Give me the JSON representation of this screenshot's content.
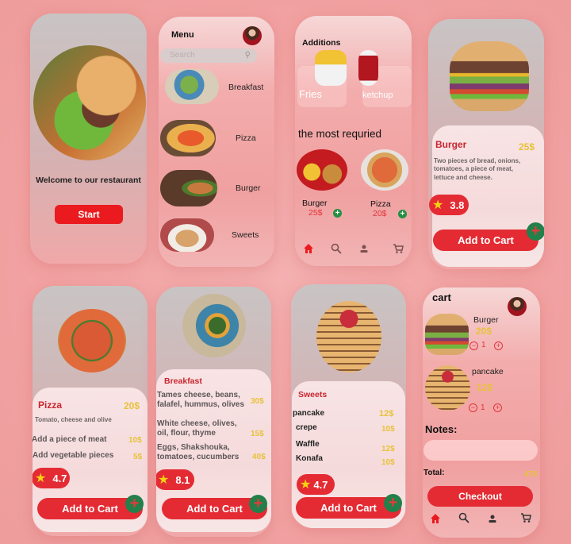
{
  "colors": {
    "accent_red": "#e42b33",
    "title_red": "#c9252f",
    "price_gold": "#e7c23a",
    "plus_green": "#24804a",
    "background_pink": "#f2a2a2"
  },
  "welcome": {
    "image": "burger-photo",
    "title": "Welcome to our restaurant",
    "start_label": "Start"
  },
  "menu": {
    "title": "Menu",
    "avatar": "user-avatar",
    "search_placeholder": "Search",
    "categories": [
      {
        "label": "Breakfast",
        "image": "breakfast-photo"
      },
      {
        "label": "Pizza",
        "image": "pizza-photo"
      },
      {
        "label": "Burger",
        "image": "burger-photo"
      },
      {
        "label": "Sweets",
        "image": "pancake-photo"
      }
    ]
  },
  "home": {
    "additions_title": "Additions",
    "additions": [
      {
        "label": "Fries",
        "image": "fries-photo"
      },
      {
        "label": "ketchup",
        "image": "ketchup-photo"
      }
    ],
    "popular_title": "the most requried",
    "popular": [
      {
        "name": "Burger",
        "price": "25$",
        "image": "burger-fries-photo"
      },
      {
        "name": "Pizza",
        "price": "20$",
        "image": "pizza-photo"
      }
    ],
    "nav": [
      "home-icon",
      "search-icon",
      "user-icon",
      "cart-icon"
    ]
  },
  "burger_detail": {
    "name": "Burger",
    "price": "25$",
    "description": "Two pieces of bread, onions, tomatoes, a piece of meat, lettuce and cheese.",
    "rating": "3.8",
    "add_label": "Add  to Cart",
    "plus": "+"
  },
  "pizza_detail": {
    "name": "Pizza",
    "price": "20$",
    "description": "Tomato, cheese and olive",
    "extras": [
      {
        "label": "Add a piece of meat",
        "price": "10$"
      },
      {
        "label": "Add vegetable pieces",
        "price": "5$"
      }
    ],
    "rating": "4.7",
    "add_label": "Add  to Cart",
    "plus": "+"
  },
  "breakfast_detail": {
    "name": "Breakfast",
    "items": [
      {
        "label": "Tames cheese, beans, falafel, hummus, olives",
        "price": "30$"
      },
      {
        "label": "White cheese, olives, oil, flour, thyme",
        "price": "15$"
      },
      {
        "label": "Eggs, Shakshouka, tomatoes, cucumbers",
        "price": "40$"
      }
    ],
    "rating": "8.1",
    "add_label": "Add  to Cart",
    "plus": "+"
  },
  "sweets_detail": {
    "name": "Sweets",
    "items": [
      {
        "label": "pancake",
        "price": "12$"
      },
      {
        "label": "crepe",
        "price": "10$"
      },
      {
        "label": "Waffle",
        "price": "12$"
      },
      {
        "label": "Konafa",
        "price": "10$"
      }
    ],
    "rating": "4.7",
    "add_label": "Add  to Cart",
    "plus": "+"
  },
  "cart": {
    "title": "cart",
    "items": [
      {
        "name": "Burger",
        "price": "20$",
        "qty": "1"
      },
      {
        "name": "pancake",
        "price": "12$",
        "qty": "1"
      }
    ],
    "notes_label": "Notes:",
    "notes_value": "",
    "total_label": "Total:",
    "total_value": "47$",
    "checkout_label": "Checkout",
    "minus": "−",
    "plus": "+"
  }
}
